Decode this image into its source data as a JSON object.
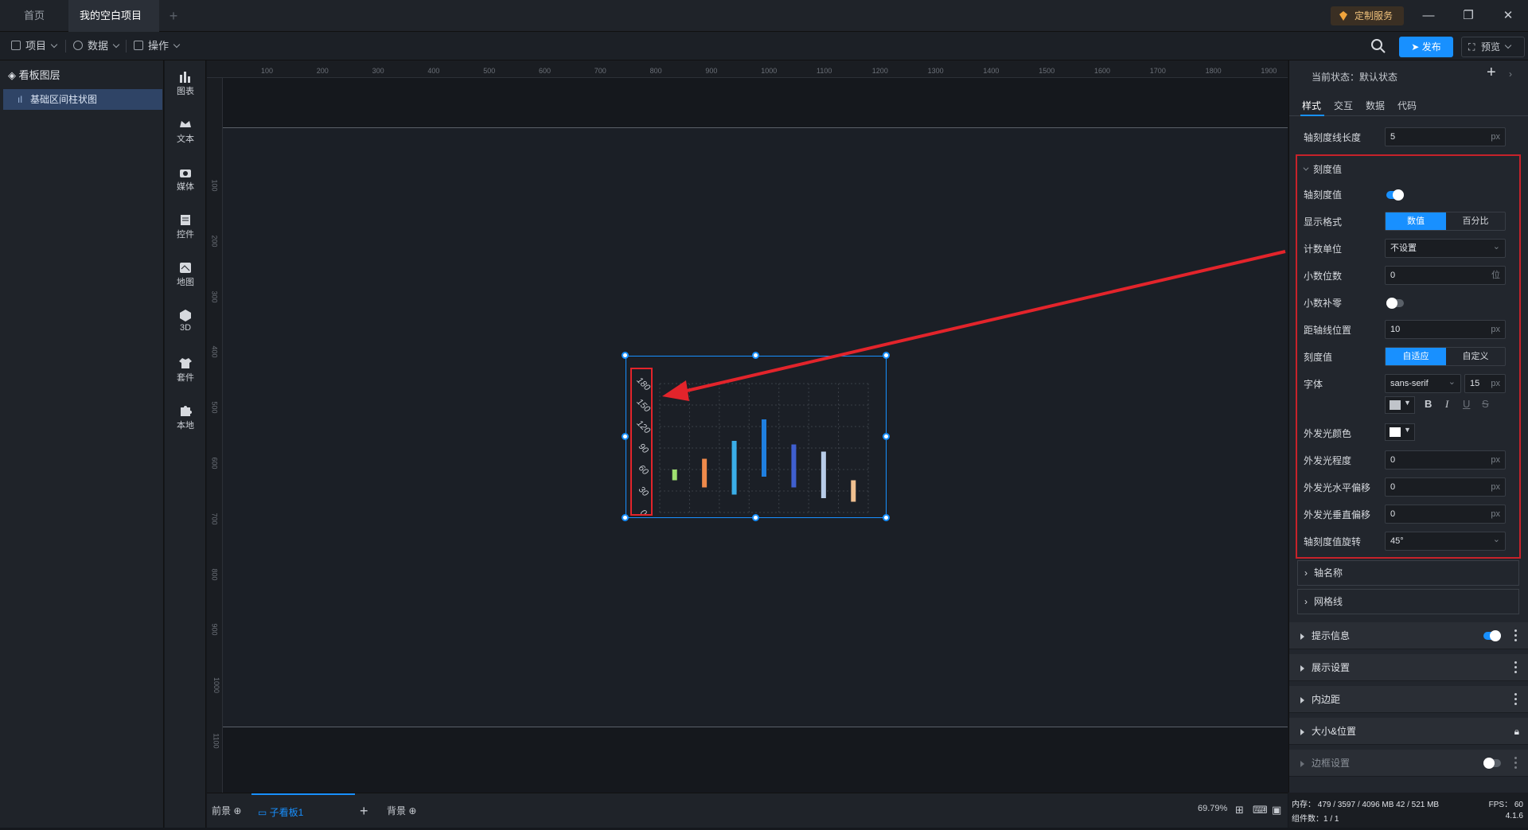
{
  "titlebar": {
    "tabs": [
      "首页",
      "我的空白项目"
    ],
    "custom_service": "定制服务"
  },
  "menubar": {
    "items": [
      "项目",
      "数据",
      "操作"
    ],
    "publish": "发布",
    "preview": "预览"
  },
  "layers": {
    "title": "看板图层",
    "item": "基础区间柱状图"
  },
  "tools": [
    "图表",
    "文本",
    "媒体",
    "控件",
    "地图",
    "3D",
    "套件",
    "本地"
  ],
  "ruler": {
    "top": [
      "100",
      "200",
      "300",
      "400",
      "500",
      "600",
      "700",
      "800",
      "900",
      "1000",
      "1100",
      "1200",
      "1300",
      "1400",
      "1500",
      "1600",
      "1700",
      "1800",
      "1900"
    ],
    "left": [
      "100",
      "200",
      "300",
      "400",
      "500",
      "600",
      "700",
      "800",
      "900",
      "1000",
      "1100"
    ]
  },
  "chart_data": {
    "type": "bar",
    "ytick_labels": [
      "180",
      "150",
      "120",
      "90",
      "60",
      "30",
      "0"
    ],
    "ylim": [
      0,
      180
    ],
    "bars": [
      {
        "low": 45,
        "high": 60,
        "color": "#a0e070"
      },
      {
        "low": 35,
        "high": 75,
        "color": "#f08a4b"
      },
      {
        "low": 25,
        "high": 100,
        "color": "#3aaee8"
      },
      {
        "low": 50,
        "high": 130,
        "color": "#1f7fe0"
      },
      {
        "low": 35,
        "high": 95,
        "color": "#3f5fd0"
      },
      {
        "low": 20,
        "high": 85,
        "color": "#b8cce8"
      },
      {
        "low": 15,
        "high": 45,
        "color": "#f0c090"
      }
    ]
  },
  "bottom": {
    "foreground": "前景",
    "subboard": "子看板1",
    "background": "背景",
    "zoom": "69.79%"
  },
  "rpanel": {
    "state_label": "当前状态：默认状态",
    "tabs": [
      "样式",
      "交互",
      "数据",
      "代码"
    ],
    "tick_length_label": "轴刻度线长度",
    "tick_length_value": "5",
    "unit_px": "px",
    "section_title": "刻度值",
    "rows": {
      "axis_tick_value": "轴刻度值",
      "display_format": "显示格式",
      "format_on": "数值",
      "format_off": "百分比",
      "unit_label": "计数单位",
      "unit_value": "不设置",
      "decimals_label": "小数位数",
      "decimals_value": "0",
      "decimals_unit": "位",
      "zero_pad": "小数补零",
      "distance_label": "距轴线位置",
      "distance_value": "10",
      "tick_values_label": "刻度值",
      "tick_on": "自适应",
      "tick_off": "自定义",
      "font_label": "字体",
      "font_value": "sans-serif",
      "font_size": "15",
      "glow_color": "外发光颜色",
      "glow_degree": "外发光程度",
      "glow_degree_value": "0",
      "glow_h": "外发光水平偏移",
      "glow_h_value": "0",
      "glow_v": "外发光垂直偏移",
      "glow_v_value": "0",
      "rotation_label": "轴刻度值旋转",
      "rotation_value": "45°"
    },
    "axis_name": "轴名称",
    "grid_lines": "网格线",
    "groups": [
      "提示信息",
      "展示设置",
      "内边距",
      "大小&位置",
      "边框设置"
    ]
  },
  "status": {
    "memory": "内存： 479 / 3597 / 4096 MB  42 / 521 MB",
    "fps": "FPS：  60",
    "components": "组件数：1 / 1",
    "version": "4.1.6"
  }
}
